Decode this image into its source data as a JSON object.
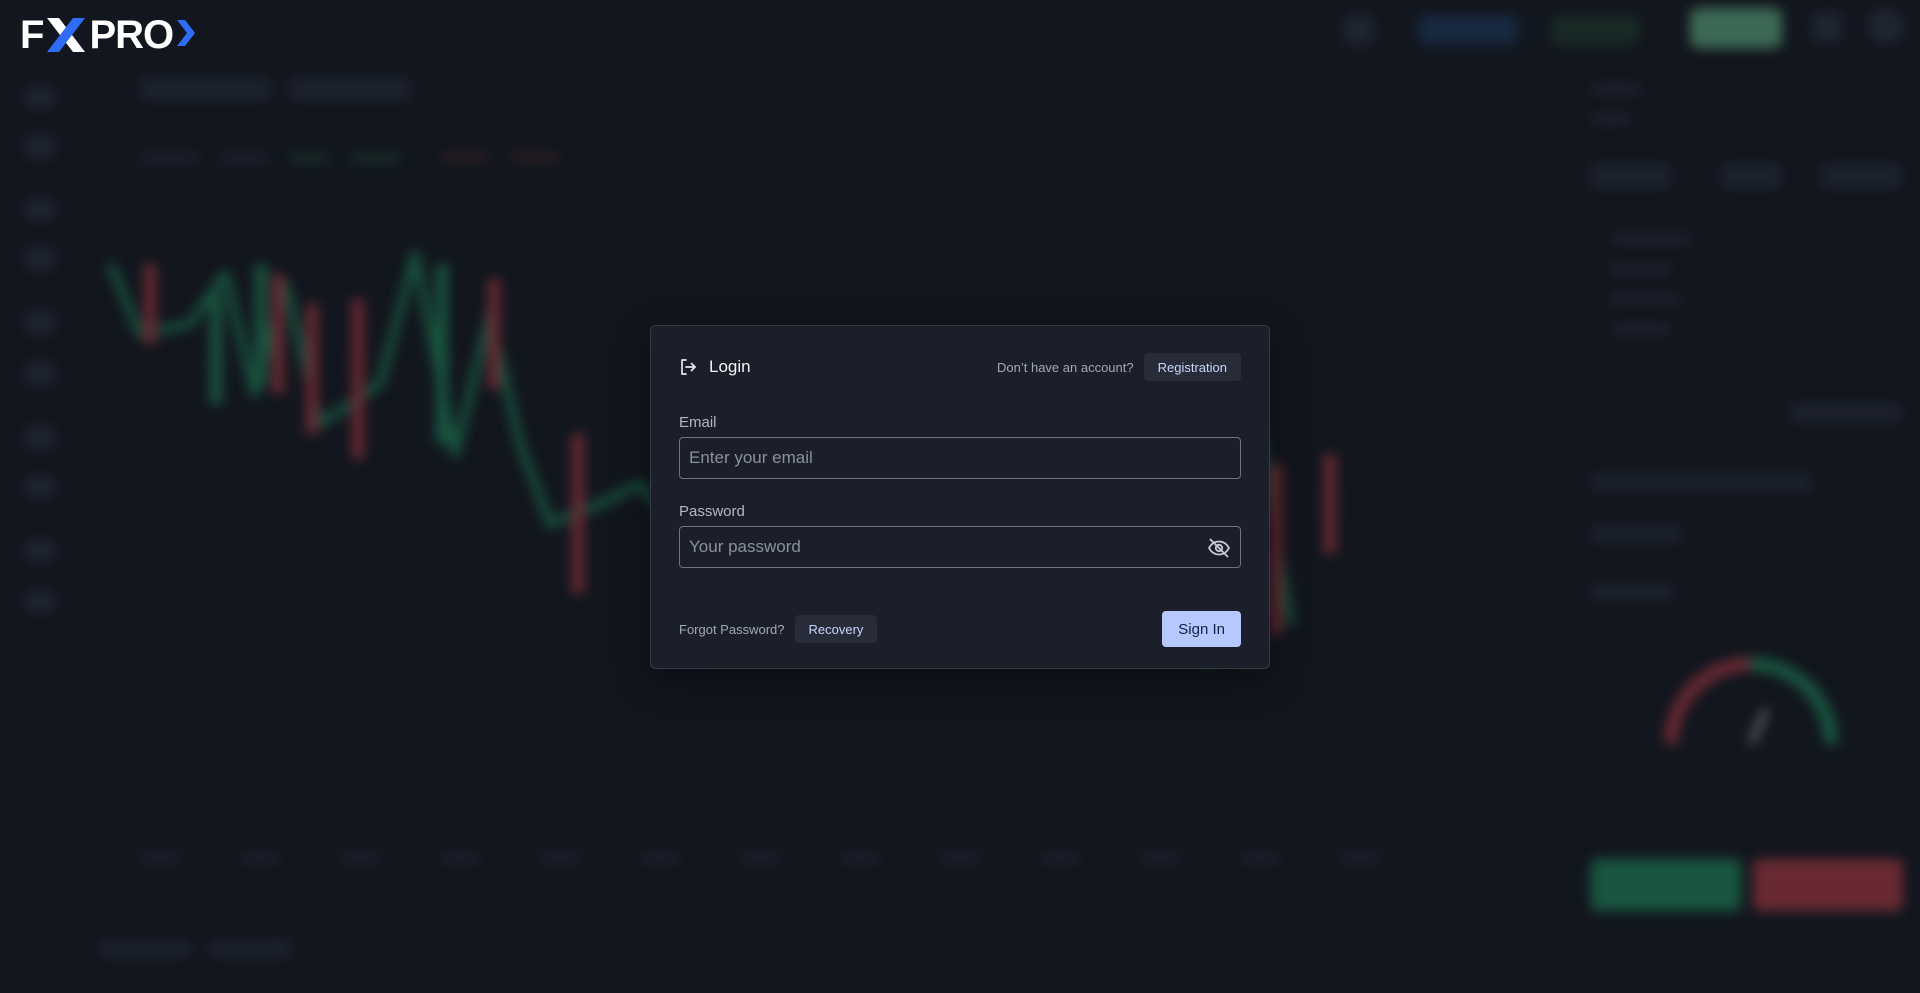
{
  "brand": {
    "logo_text_left": "F",
    "logo_text_right": "PRO",
    "logo_x_color": "#2f6cf6",
    "logo_chevron_color": "#2f6cf6"
  },
  "login": {
    "title": "Login",
    "no_account_text": "Don’t have an account?",
    "registration_label": "Registration",
    "email": {
      "label": "Email",
      "placeholder": "Enter your email",
      "value": ""
    },
    "password": {
      "label": "Password",
      "placeholder": "Your password",
      "value": "",
      "visibility_icon": "eye-off-icon"
    },
    "forgot_text": "Forgot Password?",
    "recovery_label": "Recovery",
    "sign_in_label": "Sign In"
  },
  "colors": {
    "background": "#12161e",
    "modal_background": "#1b1f29",
    "accent_button": "#b7c8ff",
    "candle_up": "#1f8a5c",
    "candle_down": "#b13a44"
  }
}
